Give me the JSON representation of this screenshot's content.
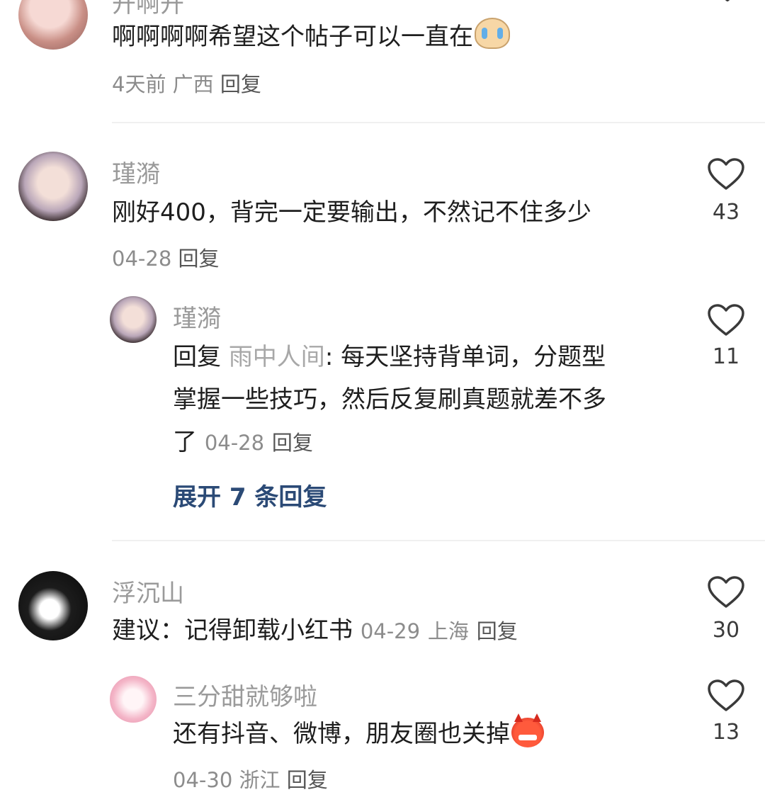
{
  "comments": [
    {
      "name": "开啊开",
      "text": "啊啊啊啊希望这个帖子可以一直在",
      "emoji": "crying-face-emoji",
      "meta": {
        "time": "4天前",
        "location": "广西",
        "reply": "回复"
      }
    },
    {
      "name": "瑾漪",
      "text": "刚好400，背完一定要输出，不然记不住多少",
      "likes": "43",
      "meta": {
        "time": "04-28",
        "reply": "回复"
      },
      "replies": [
        {
          "name": "瑾漪",
          "reply_prefix": "回复",
          "reply_to": "雨中人间",
          "text_line1": ": 每天坚持背单词，分题型",
          "text_line2": "掌握一些技巧，然后反复刷真题就差不多",
          "text_line3": "了",
          "likes": "11",
          "meta": {
            "time": "04-28",
            "reply": "回复"
          }
        }
      ],
      "expand_label": "展开 7 条回复"
    },
    {
      "name": "浮沉山",
      "text": "建议：记得卸载小红书",
      "likes": "30",
      "meta": {
        "time": "04-29",
        "location": "上海",
        "reply": "回复"
      },
      "replies": [
        {
          "name": "三分甜就够啦",
          "text": "还有抖音、微博，朋友圈也关掉",
          "emoji": "angry-devil-emoji",
          "likes": "13",
          "meta": {
            "time": "04-30",
            "location": "浙江",
            "reply": "回复"
          }
        }
      ]
    }
  ],
  "colors": {
    "expand_link": "#2b4a76",
    "name": "#9a9a9a",
    "meta": "#8c8c8c"
  }
}
